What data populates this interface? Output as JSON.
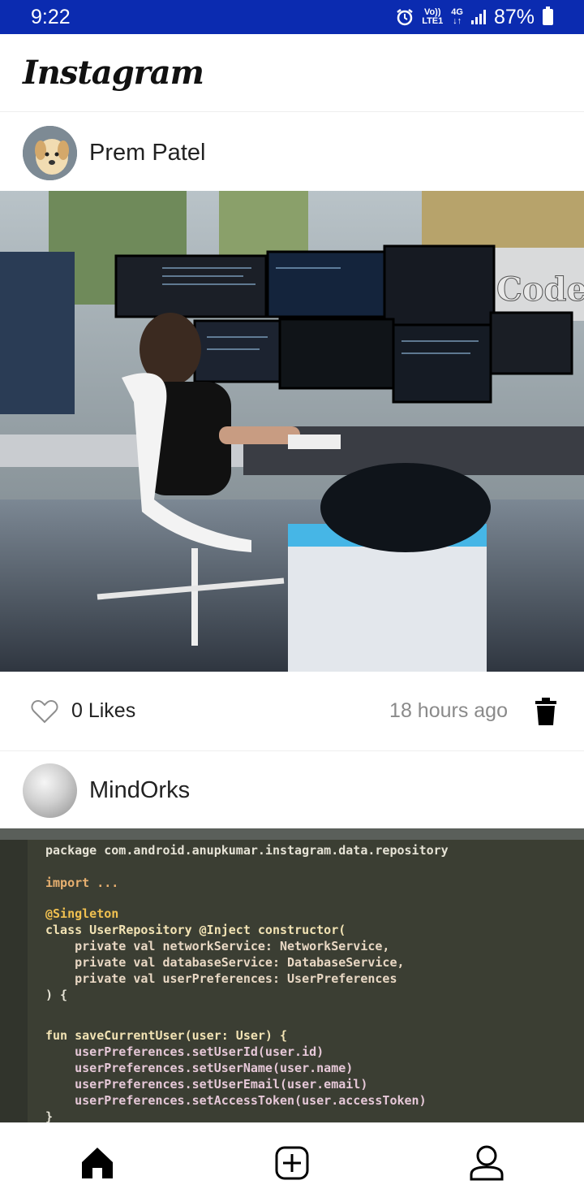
{
  "status_bar": {
    "time": "9:22",
    "volte_top": "Vo))",
    "volte_bottom": "LTE1",
    "network_top": "4G",
    "network_bottom": "↓↑",
    "battery": "87%"
  },
  "app": {
    "title": "Instagram"
  },
  "posts": [
    {
      "user": "Prem Patel",
      "avatar_icon": "dog-avatar",
      "likes": "0 Likes",
      "time": "18 hours ago",
      "image_caption_sign": "Code"
    },
    {
      "user": "MindOrks",
      "avatar_icon": "gray-ball-avatar",
      "code_lines": [
        "package com.android.anupkumar.instagram.data.repository",
        "import ...",
        "@Singleton",
        "class UserRepository @Inject constructor(",
        "    private val networkService: NetworkService,",
        "    private val databaseService: DatabaseService,",
        "    private val userPreferences: UserPreferences",
        ") {",
        "fun saveCurrentUser(user: User) {",
        "    userPreferences.setUserId(user.id)",
        "    userPreferences.setUserName(user.name)",
        "    userPreferences.setUserEmail(user.email)",
        "    userPreferences.setAccessToken(user.accessToken)",
        "}"
      ]
    }
  ],
  "nav": {
    "items": [
      "home-icon",
      "add-post-icon",
      "profile-icon"
    ]
  },
  "colors": {
    "status_bar": "#0b2bb0",
    "text": "#222222",
    "muted": "#8a8a8a"
  }
}
